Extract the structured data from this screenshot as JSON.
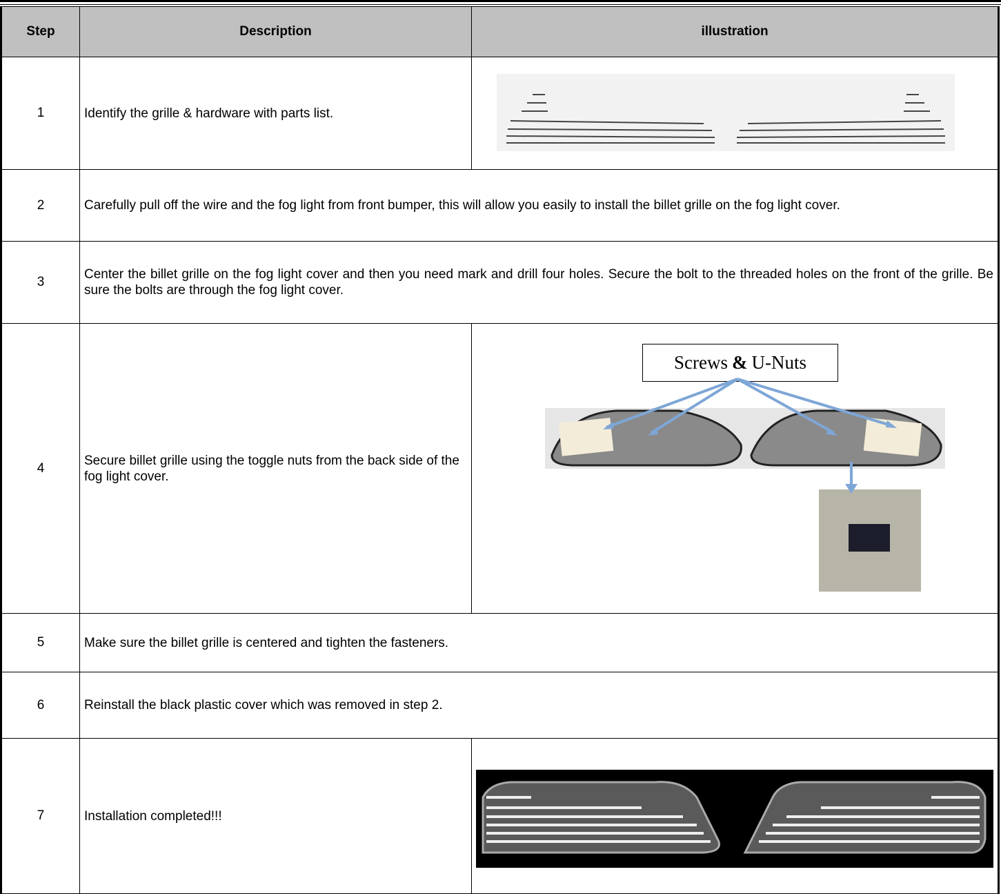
{
  "table": {
    "headers": {
      "step": "Step",
      "description": "Description",
      "illustration": "illustration"
    },
    "rows": [
      {
        "step": "1",
        "description": "Identify the grille & hardware with parts list."
      },
      {
        "step": "2",
        "description": "Carefully pull off the wire and the fog light from front bumper, this will allow you easily to install the billet grille on the fog light cover."
      },
      {
        "step": "3",
        "description": "Center the billet grille on the fog light cover and then you need mark and drill four holes. Secure the bolt to the threaded holes on the front of the grille. Be sure the bolts are through the fog light cover."
      },
      {
        "step": "4",
        "description": "Secure billet grille using the toggle nuts from the back side of the fog light cover."
      },
      {
        "step": "5",
        "description": "Make sure the billet grille is centered and tighten the fasteners."
      },
      {
        "step": "6",
        "description": "Reinstall the black plastic cover which was removed in step 2."
      },
      {
        "step": "7",
        "description": "Installation completed!!!"
      }
    ]
  },
  "callout": {
    "left": "Screws",
    "amp": "&",
    "right": "U-Nuts"
  },
  "colors": {
    "header_bg": "#c0c0c0",
    "arrow": "#7ea6d6"
  }
}
